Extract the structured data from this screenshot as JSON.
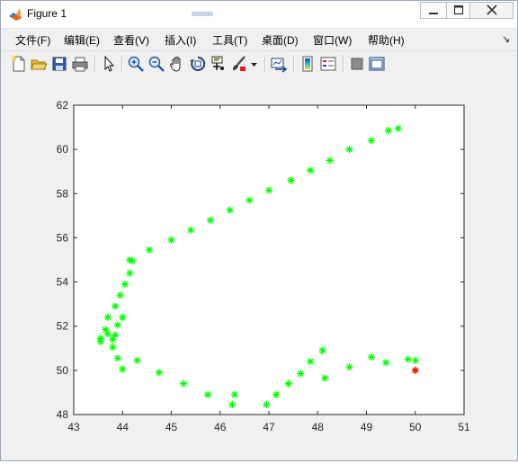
{
  "window": {
    "title": "Figure 1"
  },
  "menu": [
    "文件(F)",
    "编辑(E)",
    "查看(V)",
    "插入(I)",
    "工具(T)",
    "桌面(D)",
    "窗口(W)",
    "帮助(H)"
  ],
  "colors": {
    "marker": "#00ff00",
    "last_marker": "#ff0000",
    "axes_bg": "#ffffff",
    "figure_bg": "#f0f0f0"
  },
  "toolbar_icons": [
    "new-figure-icon",
    "open-file-icon",
    "save-icon",
    "print-icon",
    "pointer-icon",
    "zoom-in-icon",
    "zoom-out-icon",
    "pan-icon",
    "rotate-3d-icon",
    "data-cursor-icon",
    "brush-icon",
    "brush-dropdown-icon",
    "link-plot-icon",
    "colorbar-icon",
    "legend-icon",
    "hide-plot-tools-icon",
    "show-plot-tools-icon"
  ],
  "chart_data": {
    "type": "scatter",
    "marker": "*",
    "xlim": [
      43,
      51
    ],
    "ylim": [
      48,
      62
    ],
    "xticks": [
      "43",
      "44",
      "45",
      "46",
      "47",
      "48",
      "49",
      "50",
      "51"
    ],
    "yticks": [
      "48",
      "50",
      "52",
      "54",
      "56",
      "58",
      "60",
      "62"
    ],
    "grid": false,
    "points": [
      [
        49.65,
        60.95
      ],
      [
        49.45,
        60.85
      ],
      [
        49.1,
        60.4
      ],
      [
        48.65,
        60.0
      ],
      [
        48.25,
        59.5
      ],
      [
        47.85,
        59.05
      ],
      [
        47.45,
        58.6
      ],
      [
        47.0,
        58.15
      ],
      [
        46.6,
        57.7
      ],
      [
        46.2,
        57.25
      ],
      [
        45.8,
        56.8
      ],
      [
        45.4,
        56.35
      ],
      [
        45.0,
        55.9
      ],
      [
        44.55,
        55.45
      ],
      [
        44.2,
        54.95
      ],
      [
        44.15,
        55.0
      ],
      [
        44.15,
        54.4
      ],
      [
        44.05,
        53.9
      ],
      [
        43.95,
        53.4
      ],
      [
        43.85,
        52.9
      ],
      [
        44.0,
        52.4
      ],
      [
        43.7,
        52.4
      ],
      [
        43.9,
        52.05
      ],
      [
        43.65,
        51.85
      ],
      [
        43.7,
        51.65
      ],
      [
        43.85,
        51.6
      ],
      [
        43.8,
        51.4
      ],
      [
        43.55,
        51.45
      ],
      [
        43.55,
        51.3
      ],
      [
        43.8,
        51.05
      ],
      [
        43.9,
        50.55
      ],
      [
        44.3,
        50.45
      ],
      [
        44.0,
        50.05
      ],
      [
        44.75,
        49.9
      ],
      [
        45.25,
        49.4
      ],
      [
        45.75,
        48.9
      ],
      [
        46.3,
        48.9
      ],
      [
        46.25,
        48.45
      ],
      [
        46.95,
        48.45
      ],
      [
        47.15,
        48.9
      ],
      [
        47.4,
        49.4
      ],
      [
        47.65,
        49.85
      ],
      [
        47.85,
        50.4
      ],
      [
        48.1,
        50.9
      ],
      [
        48.15,
        49.65
      ],
      [
        48.65,
        50.15
      ],
      [
        49.1,
        50.6
      ],
      [
        49.4,
        50.35
      ],
      [
        49.85,
        50.5
      ],
      [
        50.0,
        50.45
      ],
      [
        50.0,
        50.0
      ]
    ]
  }
}
